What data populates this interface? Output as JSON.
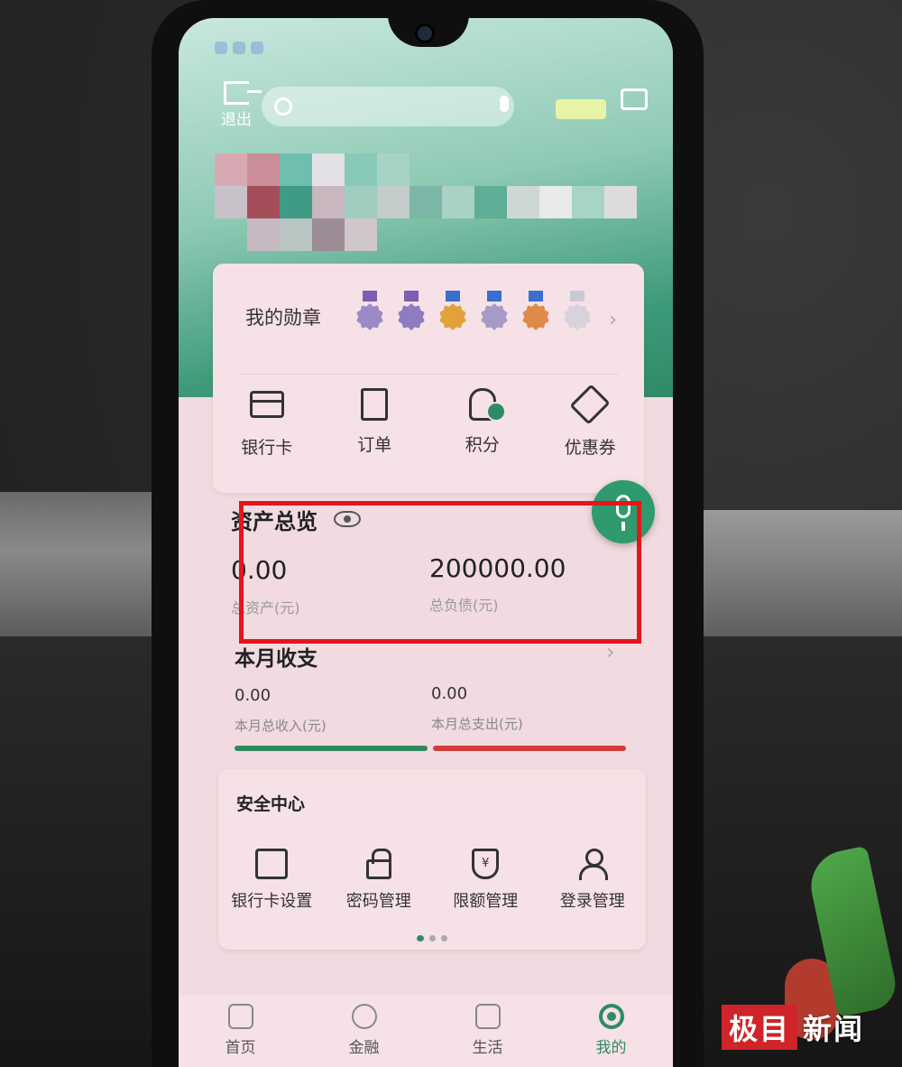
{
  "header": {
    "logout_label": "退出"
  },
  "medals": {
    "title": "我的勋章",
    "items": [
      {
        "ribbon": "#7a5fb0",
        "badge": "#9c8ac7"
      },
      {
        "ribbon": "#7a5fb0",
        "badge": "#8d7cc0"
      },
      {
        "ribbon": "#3a6fd0",
        "badge": "#e2a23a"
      },
      {
        "ribbon": "#3a6fd0",
        "badge": "#a79ac7"
      },
      {
        "ribbon": "#3a6fd0",
        "badge": "#e08a4a"
      },
      {
        "ribbon": "#c9c9d6",
        "badge": "#d9d2dd"
      }
    ]
  },
  "quick_actions": [
    {
      "label": "银行卡",
      "icon": "bank-card-icon"
    },
    {
      "label": "订单",
      "icon": "order-icon"
    },
    {
      "label": "积分",
      "icon": "points-icon"
    },
    {
      "label": "优惠券",
      "icon": "coupon-icon"
    }
  ],
  "assets": {
    "title": "资产总览",
    "total_assets_value": "0.00",
    "total_assets_label": "总资产(元)",
    "total_liabilities_value": "200000.00",
    "total_liabilities_label": "总负债(元)"
  },
  "monthly": {
    "title": "本月收支",
    "income_value": "0.00",
    "income_label": "本月总收入(元)",
    "expense_value": "0.00",
    "expense_label": "本月总支出(元)"
  },
  "security": {
    "title": "安全中心",
    "items": [
      {
        "label": "银行卡设置",
        "icon": "card-settings-icon"
      },
      {
        "label": "密码管理",
        "icon": "lock-icon"
      },
      {
        "label": "限额管理",
        "icon": "limit-shield-icon"
      },
      {
        "label": "登录管理",
        "icon": "user-login-icon"
      }
    ],
    "shield_glyph": "¥"
  },
  "bottom_nav": [
    {
      "label": "首页",
      "icon": "home-icon"
    },
    {
      "label": "金融",
      "icon": "finance-icon"
    },
    {
      "label": "生活",
      "icon": "life-icon"
    },
    {
      "label": "我的",
      "icon": "profile-icon"
    }
  ],
  "watermark": {
    "red_part": "极目",
    "white_part": "新闻"
  },
  "colors": {
    "accent_green": "#2f8a68",
    "highlight_red": "#e5151b"
  }
}
